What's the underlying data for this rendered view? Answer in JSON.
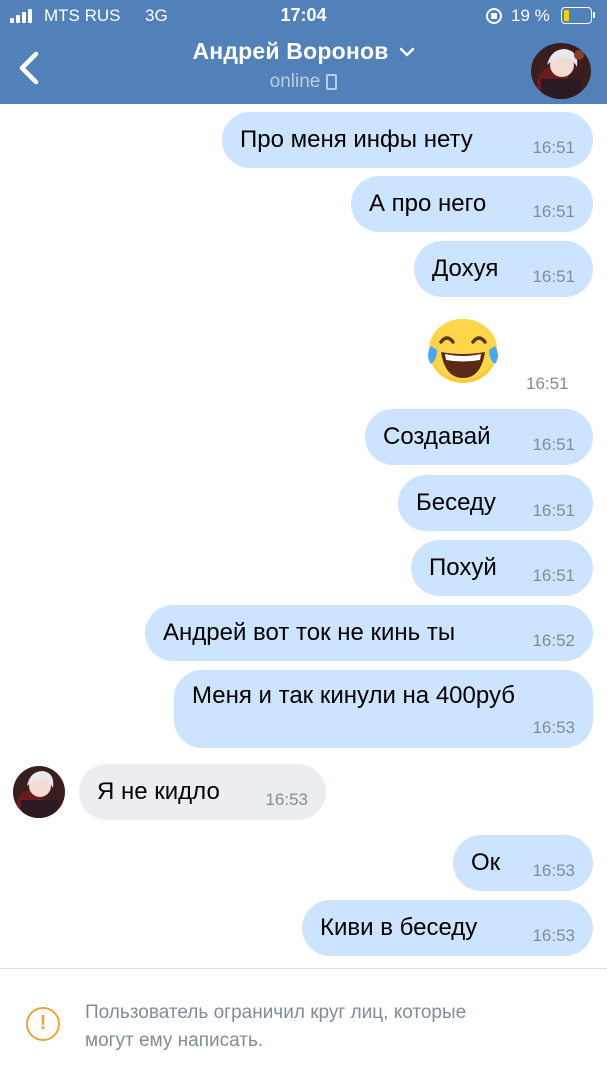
{
  "status_bar": {
    "carrier": "MTS RUS",
    "network": "3G",
    "time": "17:04",
    "battery_percent": "19 %",
    "battery_level": 0.19
  },
  "header": {
    "name": "Андрей Воронов",
    "status": "online",
    "accent_color": "#5181b8"
  },
  "messages": [
    {
      "direction": "out",
      "text": "Про меня инфы нету",
      "time": "16:51"
    },
    {
      "direction": "out",
      "text": "А про него",
      "time": "16:51"
    },
    {
      "direction": "out",
      "text": "Дохуя",
      "time": "16:51"
    },
    {
      "direction": "out",
      "type": "emoji",
      "emoji_name": "face-with-tears-of-joy",
      "time": "16:51"
    },
    {
      "direction": "out",
      "text": "Создавай",
      "time": "16:51"
    },
    {
      "direction": "out",
      "text": "Беседу",
      "time": "16:51"
    },
    {
      "direction": "out",
      "text": "Похуй",
      "time": "16:51"
    },
    {
      "direction": "out",
      "text": "Андрей вот ток не кинь ты",
      "time": "16:52"
    },
    {
      "direction": "out",
      "text": "Меня и так кинули на 400руб",
      "time": "16:53"
    },
    {
      "direction": "in",
      "text": "Я не кидло",
      "time": "16:53"
    },
    {
      "direction": "out",
      "text": "Ок",
      "time": "16:53"
    },
    {
      "direction": "out",
      "text": "Киви в беседу",
      "time": "16:53"
    }
  ],
  "footer": {
    "notice": "Пользователь ограничил круг лиц, которые\nмогут ему написать.",
    "icon": "exclamation-circle-icon",
    "icon_color": "#f0a33a"
  },
  "colors": {
    "outgoing_bubble": "#cce4ff",
    "incoming_bubble": "#ebedf0",
    "timestamp": "#818c99"
  }
}
